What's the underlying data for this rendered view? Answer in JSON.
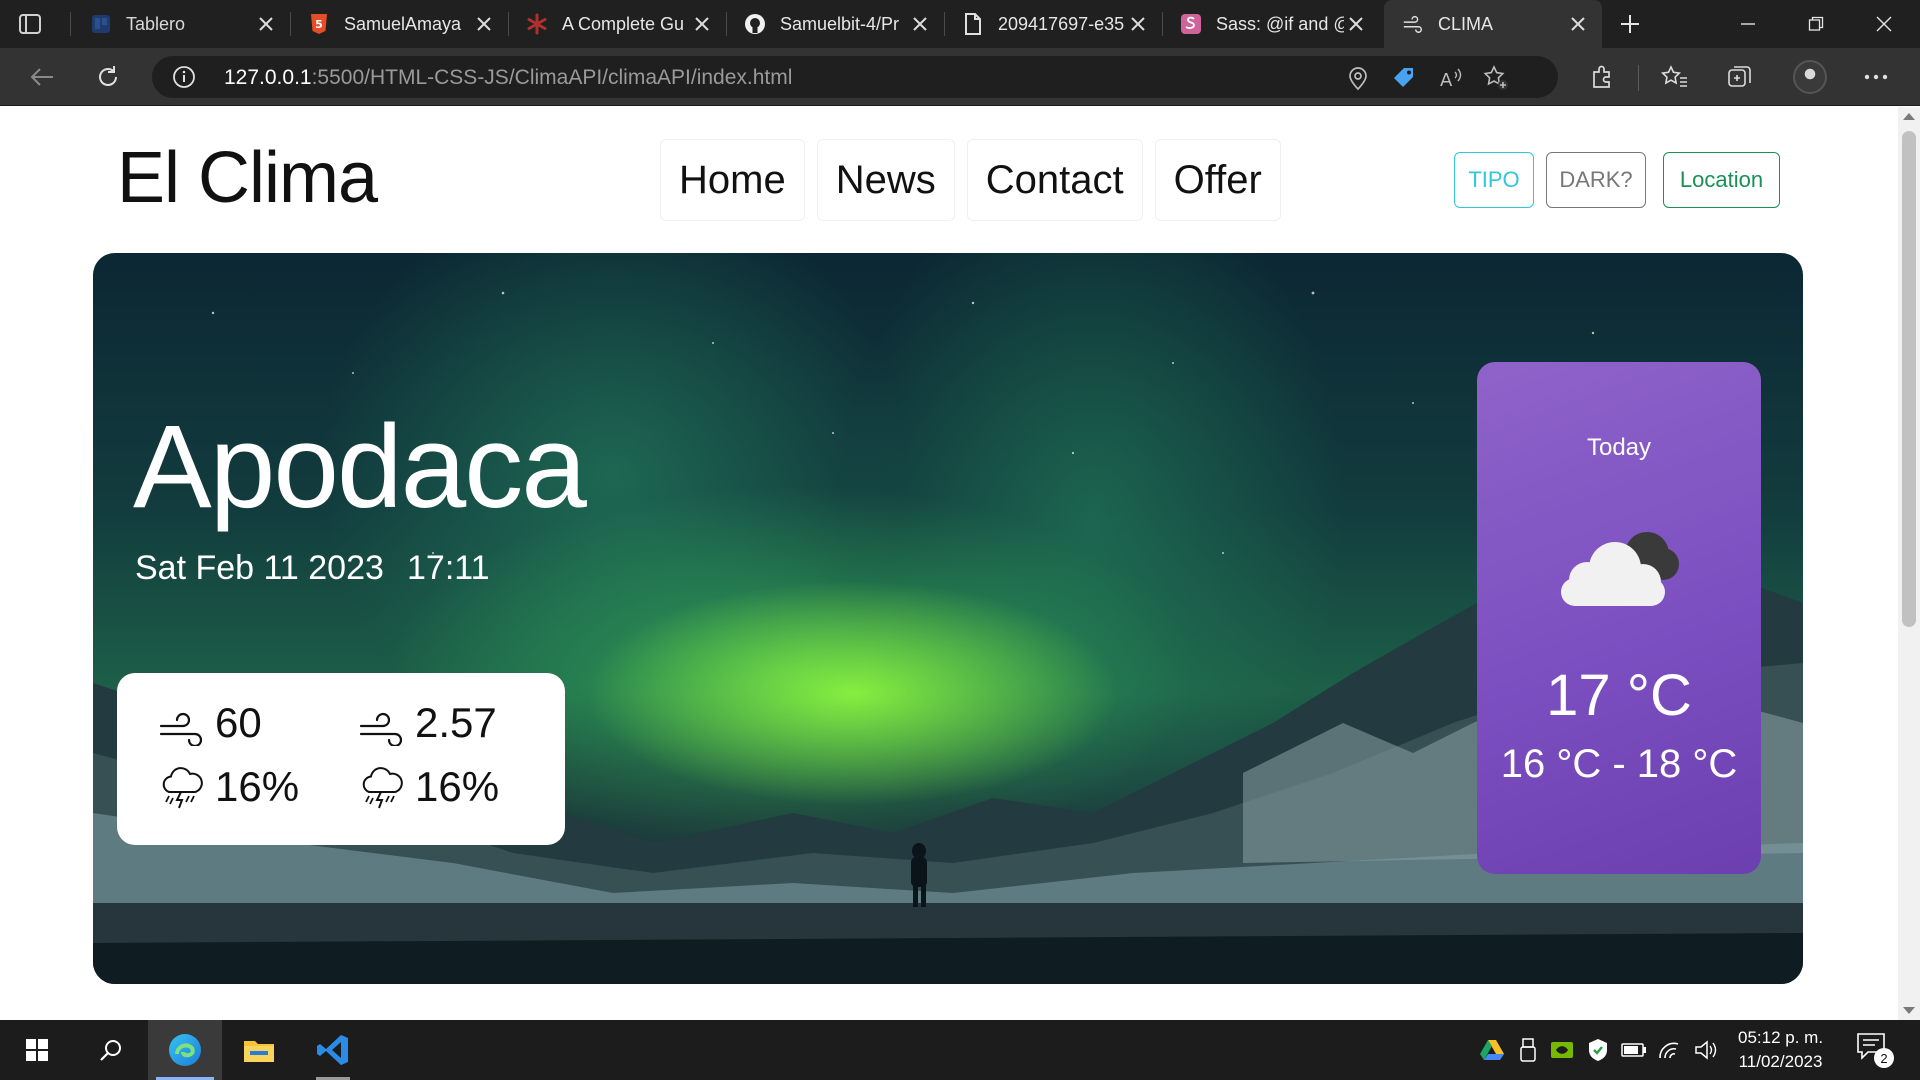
{
  "browser": {
    "tabs": [
      {
        "title": "Tablero",
        "icon": "trello-icon",
        "active": false
      },
      {
        "title": "SamuelAmaya",
        "icon": "html5-icon",
        "active": false
      },
      {
        "title": "A Complete Gu",
        "icon": "asterisk-icon",
        "active": false
      },
      {
        "title": "Samuelbit-4/Pr",
        "icon": "github-icon",
        "active": false
      },
      {
        "title": "209417697-e35",
        "icon": "file-icon",
        "active": false
      },
      {
        "title": "Sass: @if and @",
        "icon": "sass-icon",
        "active": false
      },
      {
        "title": "CLIMA",
        "icon": "wind-icon",
        "active": true
      }
    ],
    "address": {
      "host": "127.0.0.1",
      "path": ":5500/HTML-CSS-JS/ClimaAPI/climaAPI/index.html"
    }
  },
  "page": {
    "brand": "El Clima",
    "nav": [
      "Home",
      "News",
      "Contact",
      "Offer"
    ],
    "buttons": {
      "tipo": "TIPO",
      "dark": "DARK?",
      "location": "Location"
    },
    "colors": {
      "tipo": "#2ec7de",
      "dark": "#777777",
      "location": "#1a8f57",
      "today_card": "#7b4fc0"
    },
    "city": "Apodaca",
    "date": "Sat Feb 11 2023",
    "time": "17:11",
    "stats": [
      {
        "icon": "wind-icon",
        "value": "60"
      },
      {
        "icon": "wind-icon",
        "value": "2.57"
      },
      {
        "icon": "storm-cloud-icon",
        "value": "16%"
      },
      {
        "icon": "storm-cloud-icon",
        "value": "16%"
      }
    ],
    "today": {
      "label": "Today",
      "icon": "cloudy-icon",
      "temp": "17 °C",
      "range": "16 °C - 18 °C"
    }
  },
  "taskbar": {
    "clock_time": "05:12 p. m.",
    "clock_date": "11/02/2023",
    "notifications": "2"
  }
}
